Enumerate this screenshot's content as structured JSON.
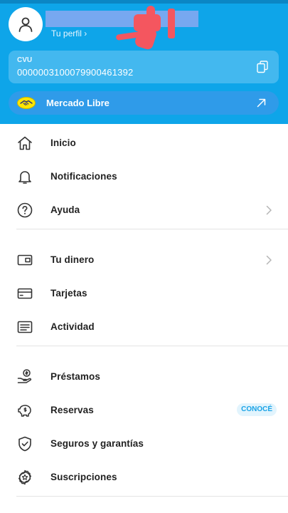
{
  "header": {
    "profile_link": "Tu perfil ›",
    "cvu_label": "CVU",
    "cvu_number": "0000003100079900461392",
    "mercado_libre_label": "Mercado Libre"
  },
  "menu": {
    "groups": [
      {
        "items": [
          {
            "name": "inicio",
            "label": "Inicio",
            "icon": "home-icon"
          },
          {
            "name": "notificaciones",
            "label": "Notificaciones",
            "icon": "bell-icon"
          },
          {
            "name": "ayuda",
            "label": "Ayuda",
            "icon": "help-icon",
            "chevron": true
          }
        ]
      },
      {
        "items": [
          {
            "name": "tu-dinero",
            "label": "Tu dinero",
            "icon": "wallet-icon",
            "chevron": true
          },
          {
            "name": "tarjetas",
            "label": "Tarjetas",
            "icon": "card-icon"
          },
          {
            "name": "actividad",
            "label": "Actividad",
            "icon": "receipt-icon"
          }
        ]
      },
      {
        "items": [
          {
            "name": "prestamos",
            "label": "Préstamos",
            "icon": "loan-icon"
          },
          {
            "name": "reservas",
            "label": "Reservas",
            "icon": "piggy-bank-icon",
            "badge": "CONOCÉ"
          },
          {
            "name": "seguros",
            "label": "Seguros y garantías",
            "icon": "shield-icon"
          },
          {
            "name": "suscripciones",
            "label": "Suscripciones",
            "icon": "star-badge-icon"
          }
        ]
      }
    ]
  },
  "colors": {
    "header_bg": "#0ea5e9",
    "card_bg": "#43b8ef",
    "ml_button_bg": "#2f9be9",
    "badge_text": "#1aa3e6",
    "redaction": "#77a8f0"
  }
}
